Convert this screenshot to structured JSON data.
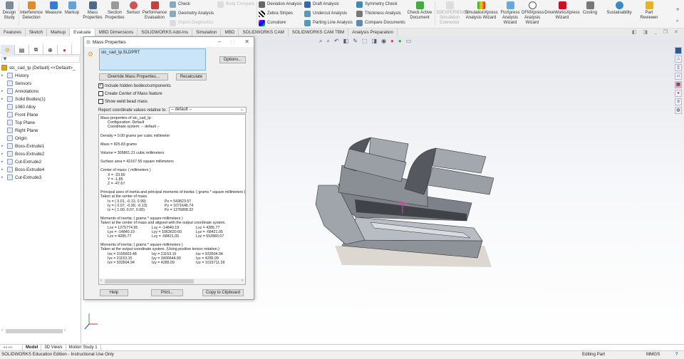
{
  "ribbon": {
    "large_buttons": [
      {
        "label": "Design Study",
        "icon": "design-study-icon"
      },
      {
        "label": "Interference Detection",
        "icon": "interference-icon"
      },
      {
        "label": "Measure",
        "icon": "measure-icon"
      },
      {
        "label": "Markup",
        "icon": "markup-icon"
      },
      {
        "label": "Mass Properties",
        "icon": "mass-properties-icon"
      },
      {
        "label": "Section Properties",
        "icon": "section-properties-icon"
      },
      {
        "label": "Sensor",
        "icon": "sensor-icon"
      },
      {
        "label": "Performance Evaluation",
        "icon": "performance-icon"
      }
    ],
    "small_buttons": [
      {
        "label": "Check"
      },
      {
        "label": "Geometry Analysis"
      },
      {
        "label": "Import Diagnostics"
      },
      {
        "label": "Body Compare"
      },
      {
        "label": "Deviation Analysis"
      },
      {
        "label": "Zebra Stripes"
      },
      {
        "label": "Curvature"
      },
      {
        "label": "Draft Analysis"
      },
      {
        "label": "Undercut Analysis"
      },
      {
        "label": "Parting Line Analysis"
      },
      {
        "label": "Symmetry Check"
      },
      {
        "label": "Thickness Analysis"
      },
      {
        "label": "Compare Documents"
      }
    ],
    "right_buttons": [
      {
        "label": "Check Active Document"
      },
      {
        "label": "3DEXPERIENCE Simulation Connector"
      },
      {
        "label": "SimulationXpress Analysis Wizard"
      },
      {
        "label": "FloXpress Analysis Wizard"
      },
      {
        "label": "DFMXpress Analysis Wizard"
      },
      {
        "label": "DriveWorksXpress Wizard"
      },
      {
        "label": "Costing"
      },
      {
        "label": "Sustainability"
      },
      {
        "label": "Part Reviewer"
      }
    ]
  },
  "tabs": [
    "Features",
    "Sketch",
    "Markup",
    "Evaluate",
    "MBD Dimensions",
    "SOLIDWORKS Add-Ins",
    "Simulation",
    "MBD",
    "SOLIDWORKS CAM",
    "SOLIDWORKS CAM TBM",
    "Analysis Preparation"
  ],
  "active_tab": "Evaluate",
  "tree": {
    "root": "stc_cad_tp (Default) <<Default>_",
    "items": [
      "History",
      "Sensors",
      "Annotations",
      "Solid Bodies(1)",
      "1060 Alloy",
      "Front Plane",
      "Top Plane",
      "Right Plane",
      "Origin",
      "Boss-Extrude1",
      "Boss-Extrude2",
      "Cut-Extrude2",
      "Boss-Extrude4",
      "Cut-Extrude3"
    ]
  },
  "dialog": {
    "title": "Mass Properties",
    "selected_file": "stc_cad_tp.SLDPRT",
    "options_label": "Options...",
    "override_label": "Override Mass Properties...",
    "recalculate_label": "Recalculate",
    "include_hidden": "Include hidden bodies/components",
    "create_com": "Create Center of Mass feature",
    "show_weld": "Show weld bead mass",
    "coord_label": "Report coordinate values relative to:",
    "coord_value": "-- default --",
    "results": {
      "header": "Mass properties of stc_cad_tp",
      "config": "Configuration: Default",
      "coordsys": "Coordinate system: -- default --",
      "density": "Density = 0.00 grams per cubic millimeter",
      "mass": "Mass = 825.83 grams",
      "volume": "Volume = 305861.21 cubic millimeters",
      "surface": "Surface area = 42167.55  square millimeters",
      "com_header": "Center of mass: ( millimeters )",
      "com_x": "X = -23.60",
      "com_y": "Y = -1.85",
      "com_z": "Z = -47.67",
      "principal_header": "Principal axes of inertia and principal moments of inertia: ( grams *  square millimeters )",
      "principal_taken": "Taken at the center of mass.",
      "principal_rows": [
        [
          "Ix = ( 0.01, -0.13,  0.99)",
          "Px = 543823.57"
        ],
        [
          "Iy = ( 0.07, -0.99, -0.13)",
          "Py = 1071646.74"
        ],
        [
          "Iz = ( 1.00,  0.07,  0.00)",
          "Pz = 1276808.32"
        ]
      ],
      "moi1_header": "Moments of inertia: ( grams *  square millimeters )",
      "moi1_taken": "Taken at the center of mass and aligned with the output coordinate system.",
      "moi1_rows": [
        [
          "Lxx = 1275774.95",
          "Lxy = -14840.19",
          "Lxz = 4285.77"
        ],
        [
          "Lyx = -14840.19",
          "Lyy = 1063620.60",
          "Lyz = -68421.05"
        ],
        [
          "Lzx = 4285.77",
          "Lzy = -68421.05",
          "Lzz = 552883.07"
        ]
      ],
      "moi2_header": "Moments of inertia: ( grams *  square millimeters )",
      "moi2_taken": "Taken at the output coordinate system. (Using positive tensor notation.)",
      "moi2_rows": [
        [
          "Ixx = 3155603.48",
          "Ixy = 21153.15",
          "Ixz = 933504.94"
        ],
        [
          "Iyx = 21153.15",
          "Iyy = 3400644.90",
          "Iyz = 4285.09"
        ],
        [
          "Izx = 933504.94",
          "Izy = 4285.09",
          "Izz = 1015711.39"
        ]
      ]
    },
    "help_label": "Help",
    "print_label": "Print...",
    "copy_label": "Copy to Clipboard"
  },
  "bottom_tabs": [
    "Model",
    "3D Views",
    "Motion Study 1"
  ],
  "status": {
    "left": "SOLIDWORKS Education Edition - Instructional Use Only",
    "mode": "Editing Part",
    "units": "MMGS"
  }
}
